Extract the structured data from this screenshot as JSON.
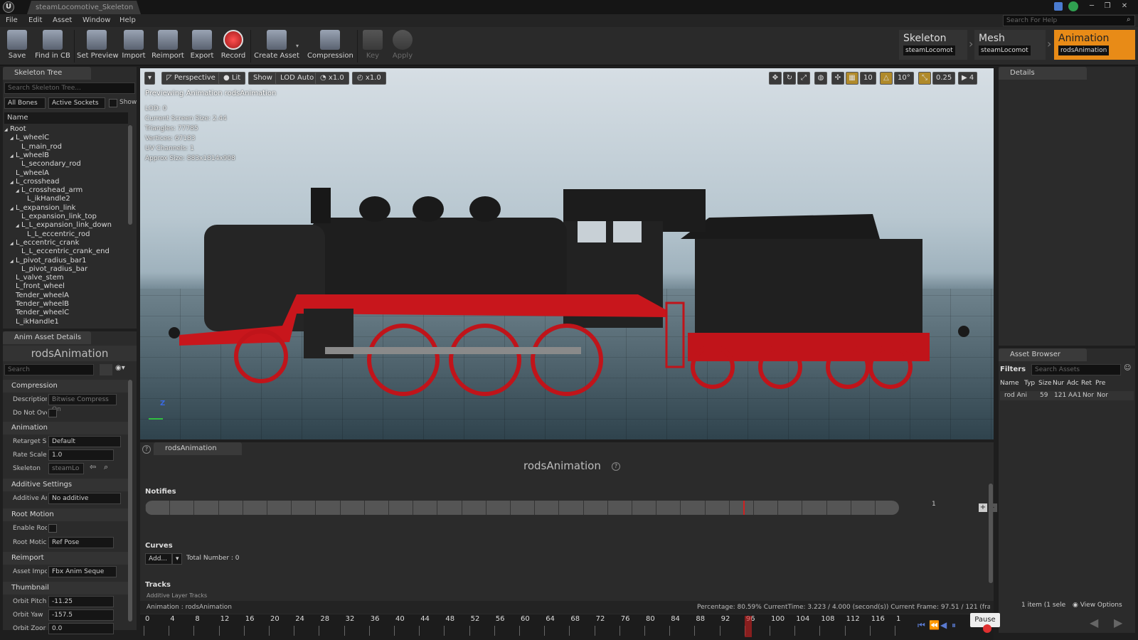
{
  "window": {
    "tab_title": "steamLocomotive_Skeleton",
    "logo": "U"
  },
  "menu": [
    "File",
    "Edit",
    "Asset",
    "Window",
    "Help"
  ],
  "help_search": {
    "placeholder": "Search For Help"
  },
  "toolbar": {
    "buttons": [
      "Save",
      "Find in CB",
      "Set Preview",
      "Import",
      "Reimport",
      "Export",
      "Record",
      "Create Asset",
      "Compression",
      "Key",
      "Apply"
    ]
  },
  "modes": {
    "skeleton": {
      "title": "Skeleton",
      "asset": "steamLocomot"
    },
    "mesh": {
      "title": "Mesh",
      "asset": "steamLocomot"
    },
    "animation": {
      "title": "Animation",
      "asset": "rodsAnimation"
    }
  },
  "skeleton_tree": {
    "tab": "Skeleton Tree",
    "search_placeholder": "Search Skeleton Tree...",
    "filter_bones": "All Bones",
    "filter_sockets": "Active Sockets",
    "show_label": "Show",
    "column_name": "Name",
    "bones": [
      {
        "label": "Root",
        "indent": 0,
        "expander": "◢"
      },
      {
        "label": "L_wheelC",
        "indent": 1,
        "expander": "◢"
      },
      {
        "label": "L_main_rod",
        "indent": 2,
        "expander": ""
      },
      {
        "label": "L_wheelB",
        "indent": 1,
        "expander": "◢"
      },
      {
        "label": "L_secondary_rod",
        "indent": 2,
        "expander": ""
      },
      {
        "label": "L_wheelA",
        "indent": 1,
        "expander": ""
      },
      {
        "label": "L_crosshead",
        "indent": 1,
        "expander": "◢"
      },
      {
        "label": "L_crosshead_arm",
        "indent": 2,
        "expander": "◢"
      },
      {
        "label": "L_ikHandle2",
        "indent": 3,
        "expander": ""
      },
      {
        "label": "L_expansion_link",
        "indent": 1,
        "expander": "◢"
      },
      {
        "label": "L_expansion_link_top",
        "indent": 2,
        "expander": ""
      },
      {
        "label": "L_L_expansion_link_down",
        "indent": 2,
        "expander": "◢"
      },
      {
        "label": "L_L_eccentric_rod",
        "indent": 3,
        "expander": ""
      },
      {
        "label": "L_eccentric_crank",
        "indent": 1,
        "expander": "◢"
      },
      {
        "label": "L_L_eccentric_crank_end",
        "indent": 2,
        "expander": ""
      },
      {
        "label": "L_pivot_radius_bar1",
        "indent": 1,
        "expander": "◢"
      },
      {
        "label": "L_pivot_radius_bar",
        "indent": 2,
        "expander": ""
      },
      {
        "label": "L_valve_stem",
        "indent": 1,
        "expander": ""
      },
      {
        "label": "L_front_wheel",
        "indent": 1,
        "expander": ""
      },
      {
        "label": "Tender_wheelA",
        "indent": 1,
        "expander": ""
      },
      {
        "label": "Tender_wheelB",
        "indent": 1,
        "expander": ""
      },
      {
        "label": "Tender_wheelC",
        "indent": 1,
        "expander": ""
      },
      {
        "label": "L_ikHandle1",
        "indent": 1,
        "expander": ""
      }
    ]
  },
  "anim_asset_details": {
    "tab": "Anim Asset Details",
    "asset_name": "rodsAnimation",
    "search_placeholder": "Search",
    "sections": {
      "compression": "Compression",
      "animation": "Animation",
      "additive": "Additive Settings",
      "root_motion": "Root Motion",
      "reimport": "Reimport",
      "thumbnail": "Thumbnail"
    },
    "props": {
      "description_label": "Descriptior",
      "description_value": "Bitwise Compress On",
      "do_not_override_label": "Do Not Ove",
      "retarget_label": "Retarget S",
      "retarget_value": "Default",
      "rate_scale_label": "Rate Scale",
      "rate_scale_value": "1.0",
      "skeleton_label": "Skeleton",
      "skeleton_value": "steamLo",
      "additive_label": "Additive Ar",
      "additive_value": "No additive",
      "enable_root_label": "Enable Roc",
      "root_motion_label": "Root Motic",
      "root_motion_value": "Ref Pose",
      "asset_import_label": "Asset Impc",
      "asset_import_value": "Fbx Anim Seque",
      "orbit_pitch_label": "Orbit Pitch",
      "orbit_pitch_value": "-11.25",
      "orbit_yaw_label": "Orbit Yaw",
      "orbit_yaw_value": "-157.5",
      "orbit_zoom_label": "Orbit Zoor",
      "orbit_zoom_value": "0.0"
    }
  },
  "viewport": {
    "buttons": {
      "perspective": "Perspective",
      "lit": "Lit",
      "show": "Show",
      "lod": "LOD Auto",
      "speed1": "x1.0",
      "speed2": "x1.0"
    },
    "right_values": {
      "grid": "10",
      "angle": "10°",
      "scale": "0.25",
      "cam": "4"
    },
    "preview_text": "Previewing Animation rodsAnimation",
    "info": [
      "LOD: 0",
      "Current Screen Size: 2.44",
      "Triangles: 77785",
      "Vertices: 67183",
      "UV Channels: 1",
      "Approx Size: 883x1814x908"
    ],
    "axis_z": "Z"
  },
  "details_panel": {
    "tab": "Details"
  },
  "asset_browser": {
    "tab": "Asset Browser",
    "filters": "Filters",
    "search_placeholder": "Search Assets",
    "columns": [
      "Name",
      "Typ",
      "Size",
      "Nur",
      "Adc",
      "Ret",
      "Pre"
    ],
    "row": [
      "rod Ani",
      "59",
      "121",
      "AA1",
      "Nor",
      "Nor"
    ],
    "status": "1 item (1 sele",
    "view_options": "View Options"
  },
  "anim_editor": {
    "tab": "rodsAnimation",
    "title": "rodsAnimation",
    "notifies": "Notifies",
    "notify_track_count": "1",
    "curves": "Curves",
    "add_label": "Add...",
    "total_number": "Total Number : 0",
    "tracks": "Tracks",
    "additive_layer": "Additive Layer Tracks"
  },
  "status_bar": {
    "animation": "Animation :  rodsAnimation",
    "info": "Percentage:  80.59% CurrentTime: 3.223 / 4.000 (second(s)) Current Frame: 97.51 / 121 (frame(s))"
  },
  "timeline": {
    "ticks": [
      "0",
      "4",
      "8",
      "12",
      "16",
      "20",
      "24",
      "28",
      "32",
      "36",
      "40",
      "44",
      "48",
      "52",
      "56",
      "60",
      "64",
      "68",
      "72",
      "76",
      "80",
      "84",
      "88",
      "92",
      "96",
      "100",
      "104",
      "108",
      "112",
      "116",
      "1"
    ],
    "current_frame": 96,
    "pause_label": "Pause"
  },
  "colors": {
    "accent": "#e88b17",
    "playhead": "#d02020",
    "record": "#e03030"
  }
}
